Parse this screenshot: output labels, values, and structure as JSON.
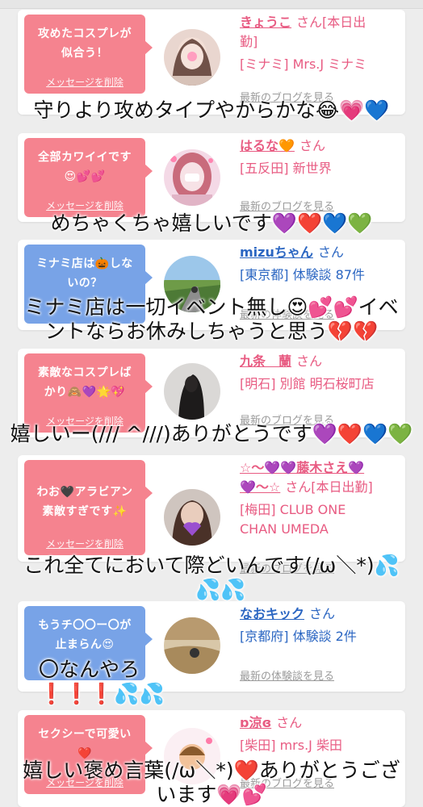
{
  "colors": {
    "pink_bubble": "#f5838f",
    "blue_bubble": "#78a3e7",
    "pink_text": "#e85b82",
    "blue_text": "#2b66c2",
    "link_gray": "#9a9a9a"
  },
  "delete_label": "メッセージを削除",
  "cards": [
    {
      "message_l1": "攻めたコスプレが",
      "message_l2": "似合う！",
      "name": "きょうこ",
      "san": "さん[本日出",
      "name_l2": "勤]",
      "shop": "[ミナミ] Mrs.J ミナミ",
      "link": "最新のブログを見る",
      "overlay_l1": "守りより攻めタイプやからかな😂💗💙"
    },
    {
      "message_l1": "全部カワイイです",
      "message_l2": "😍💕💕",
      "name": "はるな🧡",
      "san": "さん",
      "shop": "[五反田] 新世界",
      "link": "最新のブログを見る",
      "overlay_l1": "めちゃくちゃ嬉しいです💜❤️💙💚"
    },
    {
      "message_l1": "ミナミ店は🎃しな",
      "message_l2": "いの？",
      "name": "mizuちゃん",
      "san": "さん",
      "shop": "[東京都] 体験談 87件",
      "link": "最新の体験談を見る",
      "overlay_l1": "ミナミ店は一切イベント無し😍💕💕イベ",
      "overlay_l2": "ントならお休みしちゃうと思う💔💔"
    },
    {
      "message_l1": "素敵なコスプレば",
      "message_l2": "かり🙈💜🌟💖",
      "name": "九条　蘭",
      "san": "さん",
      "shop": "[明石] 別館 明石桜町店",
      "link": "最新のブログを見る",
      "overlay_l1": "嬉しいー(/// ^///)ありがとうです💜❤️💙💚"
    },
    {
      "message_l1": "わお🖤アラビアン",
      "message_l2": "素敵すぎです✨",
      "name": "☆〜💜💜藤木さえ💜",
      "name_l2": "💜〜☆",
      "san": "さん[本日出勤]",
      "shop": "[梅田] CLUB ONE",
      "shop_l2": "CHAN UMEDA",
      "link": "最新のブログを見る",
      "overlay_l1": "これ全てにおいて際どいんです(/ω＼*)💦",
      "overlay_l2": "💦💦"
    },
    {
      "message_l1": "もうチ〇〇ー〇が",
      "message_l2": "止まらん😍",
      "name": "なおキック",
      "san": "さん",
      "shop": "[京都府] 体験談 2件",
      "link": "最新の体験談を見る",
      "overlay_l1": "〇なんやろ",
      "overlay_l2": "❗❗❗💦💦"
    },
    {
      "message_l1": "セクシーで可愛い",
      "message_l2": "❤️",
      "name": "ɒ涼ɞ",
      "san": "さん",
      "shop": "[柴田] mrs.J 柴田",
      "link": "最新のブログを見る",
      "overlay_l1": "嬉しい褒め言葉(/ω＼*)❤️ありがとうござ",
      "overlay_l2": "います💗💕"
    }
  ]
}
